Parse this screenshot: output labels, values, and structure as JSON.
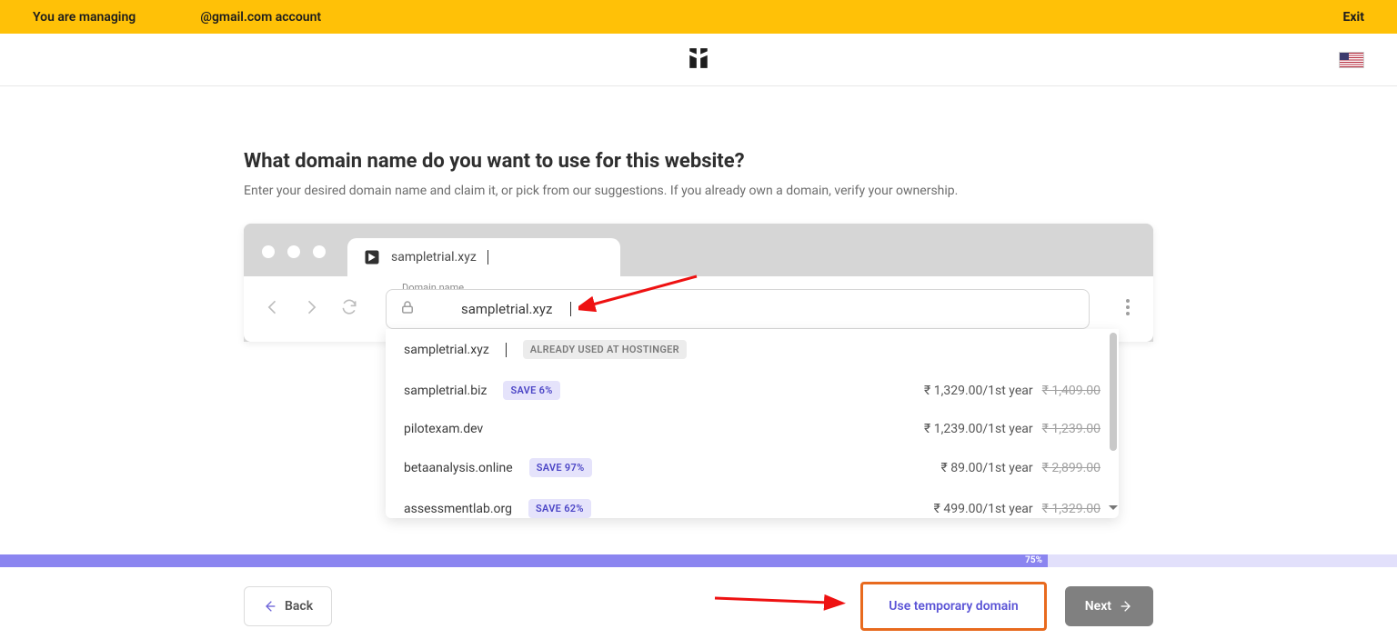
{
  "topbar": {
    "managing_prefix": "You are managing",
    "account_text": "@gmail.com account",
    "exit": "Exit"
  },
  "page": {
    "title": "What domain name do you want to use for this website?",
    "subtitle": "Enter your desired domain name and claim it, or pick from our suggestions. If you already own a domain, verify your ownership."
  },
  "browser": {
    "tab_title": "sampletrial.xyz",
    "domain_label": "Domain name",
    "domain_value": "sampletrial.xyz"
  },
  "suggestions": [
    {
      "domain": "sampletrial.xyz",
      "badge_type": "used",
      "badge_text": "ALREADY USED AT HOSTINGER",
      "price": "",
      "old_price": ""
    },
    {
      "domain": "sampletrial.biz",
      "badge_type": "save",
      "badge_text": "SAVE 6%",
      "price": "₹ 1,329.00/1st year",
      "old_price": "₹ 1,409.00"
    },
    {
      "domain": "pilotexam.dev",
      "badge_type": "",
      "badge_text": "",
      "price": "₹ 1,239.00/1st year",
      "old_price": "₹ 1,239.00"
    },
    {
      "domain": "betaanalysis.online",
      "badge_type": "save",
      "badge_text": "SAVE 97%",
      "price": "₹ 89.00/1st year",
      "old_price": "₹ 2,899.00"
    },
    {
      "domain": "assessmentlab.org",
      "badge_type": "save",
      "badge_text": "SAVE 62%",
      "price": "₹ 499.00/1st year",
      "old_price": "₹ 1,329.00"
    }
  ],
  "progress": {
    "percent_label": "75%"
  },
  "footer": {
    "back": "Back",
    "temp": "Use temporary domain",
    "next": "Next"
  }
}
